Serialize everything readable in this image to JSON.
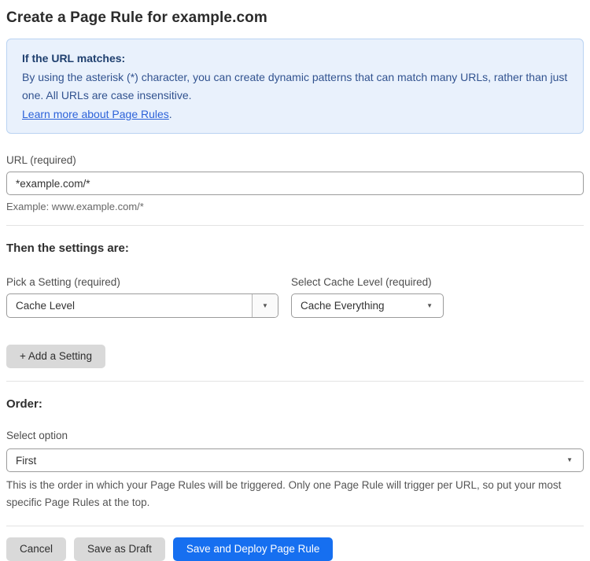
{
  "page_title": "Create a Page Rule for example.com",
  "info_box": {
    "heading": "If the URL matches:",
    "body": "By using the asterisk (*) character, you can create dynamic patterns that can match many URLs, rather than just one. All URLs are case insensitive.",
    "link_label": "Learn more about Page Rules",
    "link_suffix": "."
  },
  "url_field": {
    "label": "URL (required)",
    "value": "*example.com/*",
    "helper": "Example: www.example.com/*"
  },
  "settings_section": {
    "heading": "Then the settings are:",
    "setting_picker": {
      "label": "Pick a Setting (required)",
      "selected": "Cache Level"
    },
    "cache_level_picker": {
      "label": "Select Cache Level (required)",
      "selected": "Cache Everything"
    },
    "add_setting_label": "+ Add a Setting"
  },
  "order_section": {
    "heading": "Order:",
    "label": "Select option",
    "selected": "First",
    "helper": "This is the order in which your Page Rules will be triggered. Only one Page Rule will trigger per URL, so put your most specific Page Rules at the top."
  },
  "actions": {
    "cancel": "Cancel",
    "save_draft": "Save as Draft",
    "save_deploy": "Save and Deploy Page Rule"
  },
  "icons": {
    "dropdown_arrow": "▼"
  },
  "colors": {
    "primary_button": "#166ff0",
    "info_box_bg": "#e9f1fc",
    "info_box_border": "#bad3f2",
    "info_text": "#31528f",
    "link": "#2c62d9",
    "gray_button": "#d9d9d9"
  }
}
